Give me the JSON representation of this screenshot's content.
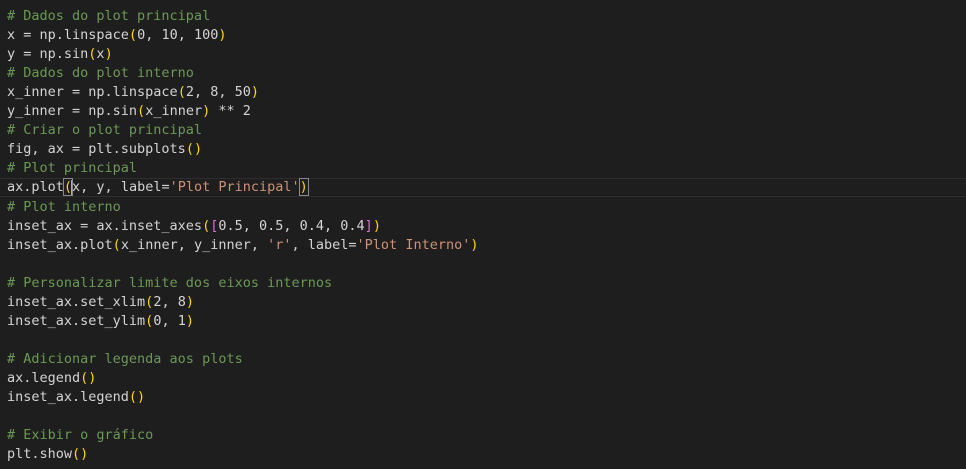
{
  "editor": {
    "language": "python",
    "lines": [
      {
        "tokens": [
          {
            "t": "# Dados do plot principal",
            "k": "comment"
          }
        ]
      },
      {
        "tokens": [
          {
            "t": "x = np.linspace",
            "k": "text"
          },
          {
            "t": "(",
            "k": "paren-1"
          },
          {
            "t": "0, 10, 100",
            "k": "text"
          },
          {
            "t": ")",
            "k": "paren-1"
          }
        ]
      },
      {
        "tokens": [
          {
            "t": "y = np.sin",
            "k": "text"
          },
          {
            "t": "(",
            "k": "paren-1"
          },
          {
            "t": "x",
            "k": "text"
          },
          {
            "t": ")",
            "k": "paren-1"
          }
        ]
      },
      {
        "tokens": [
          {
            "t": "# Dados do plot interno",
            "k": "comment"
          }
        ]
      },
      {
        "tokens": [
          {
            "t": "x_inner = np.linspace",
            "k": "text"
          },
          {
            "t": "(",
            "k": "paren-1"
          },
          {
            "t": "2, 8, 50",
            "k": "text"
          },
          {
            "t": ")",
            "k": "paren-1"
          }
        ]
      },
      {
        "tokens": [
          {
            "t": "y_inner = np.sin",
            "k": "text"
          },
          {
            "t": "(",
            "k": "paren-1"
          },
          {
            "t": "x_inner",
            "k": "text"
          },
          {
            "t": ")",
            "k": "paren-1"
          },
          {
            "t": " ** 2",
            "k": "text"
          }
        ]
      },
      {
        "tokens": [
          {
            "t": "# Criar o plot principal",
            "k": "comment"
          }
        ]
      },
      {
        "tokens": [
          {
            "t": "fig, ax = plt.subplots",
            "k": "text"
          },
          {
            "t": "()",
            "k": "paren-1"
          }
        ]
      },
      {
        "tokens": [
          {
            "t": "# Plot principal",
            "k": "comment"
          }
        ]
      },
      {
        "current": true,
        "tokens": [
          {
            "t": "ax.plot",
            "k": "text"
          },
          {
            "t": "(",
            "k": "paren-1-match"
          },
          {
            "t": "",
            "k": "cursor"
          },
          {
            "t": "x, y, label=",
            "k": "text"
          },
          {
            "t": "'Plot Principal'",
            "k": "string"
          },
          {
            "t": ")",
            "k": "paren-1-match"
          }
        ]
      },
      {
        "tokens": [
          {
            "t": "# Plot interno",
            "k": "comment"
          }
        ]
      },
      {
        "tokens": [
          {
            "t": "inset_ax = ax.inset_axes",
            "k": "text"
          },
          {
            "t": "(",
            "k": "paren-1"
          },
          {
            "t": "[",
            "k": "paren-2"
          },
          {
            "t": "0.5, 0.5, 0.4, 0.4",
            "k": "text"
          },
          {
            "t": "]",
            "k": "paren-2"
          },
          {
            "t": ")",
            "k": "paren-1"
          }
        ]
      },
      {
        "tokens": [
          {
            "t": "inset_ax.plot",
            "k": "text"
          },
          {
            "t": "(",
            "k": "paren-1"
          },
          {
            "t": "x_inner, y_inner, ",
            "k": "text"
          },
          {
            "t": "'r'",
            "k": "string"
          },
          {
            "t": ", label=",
            "k": "text"
          },
          {
            "t": "'Plot Interno'",
            "k": "string"
          },
          {
            "t": ")",
            "k": "paren-1"
          }
        ]
      },
      {
        "tokens": []
      },
      {
        "tokens": [
          {
            "t": "# Personalizar limite dos eixos internos",
            "k": "comment"
          }
        ]
      },
      {
        "tokens": [
          {
            "t": "inset_ax.set_xlim",
            "k": "text"
          },
          {
            "t": "(",
            "k": "paren-1"
          },
          {
            "t": "2, 8",
            "k": "text"
          },
          {
            "t": ")",
            "k": "paren-1"
          }
        ]
      },
      {
        "tokens": [
          {
            "t": "inset_ax.set_ylim",
            "k": "text"
          },
          {
            "t": "(",
            "k": "paren-1"
          },
          {
            "t": "0, 1",
            "k": "text"
          },
          {
            "t": ")",
            "k": "paren-1"
          }
        ]
      },
      {
        "tokens": []
      },
      {
        "tokens": [
          {
            "t": "# Adicionar legenda aos plots",
            "k": "comment"
          }
        ]
      },
      {
        "tokens": [
          {
            "t": "ax.legend",
            "k": "text"
          },
          {
            "t": "()",
            "k": "paren-1"
          }
        ]
      },
      {
        "tokens": [
          {
            "t": "inset_ax.legend",
            "k": "text"
          },
          {
            "t": "()",
            "k": "paren-1"
          }
        ]
      },
      {
        "tokens": []
      },
      {
        "tokens": [
          {
            "t": "# Exibir o gráfico",
            "k": "comment"
          }
        ]
      },
      {
        "tokens": [
          {
            "t": "plt.show",
            "k": "text"
          },
          {
            "t": "()",
            "k": "paren-1"
          }
        ]
      }
    ]
  },
  "colors": {
    "background": "#1e1e1e",
    "comment": "#6a9955",
    "text": "#d4d4d4",
    "string": "#ce9178",
    "bracket_level_1": "#ffd700",
    "bracket_level_2": "#da70d6"
  }
}
